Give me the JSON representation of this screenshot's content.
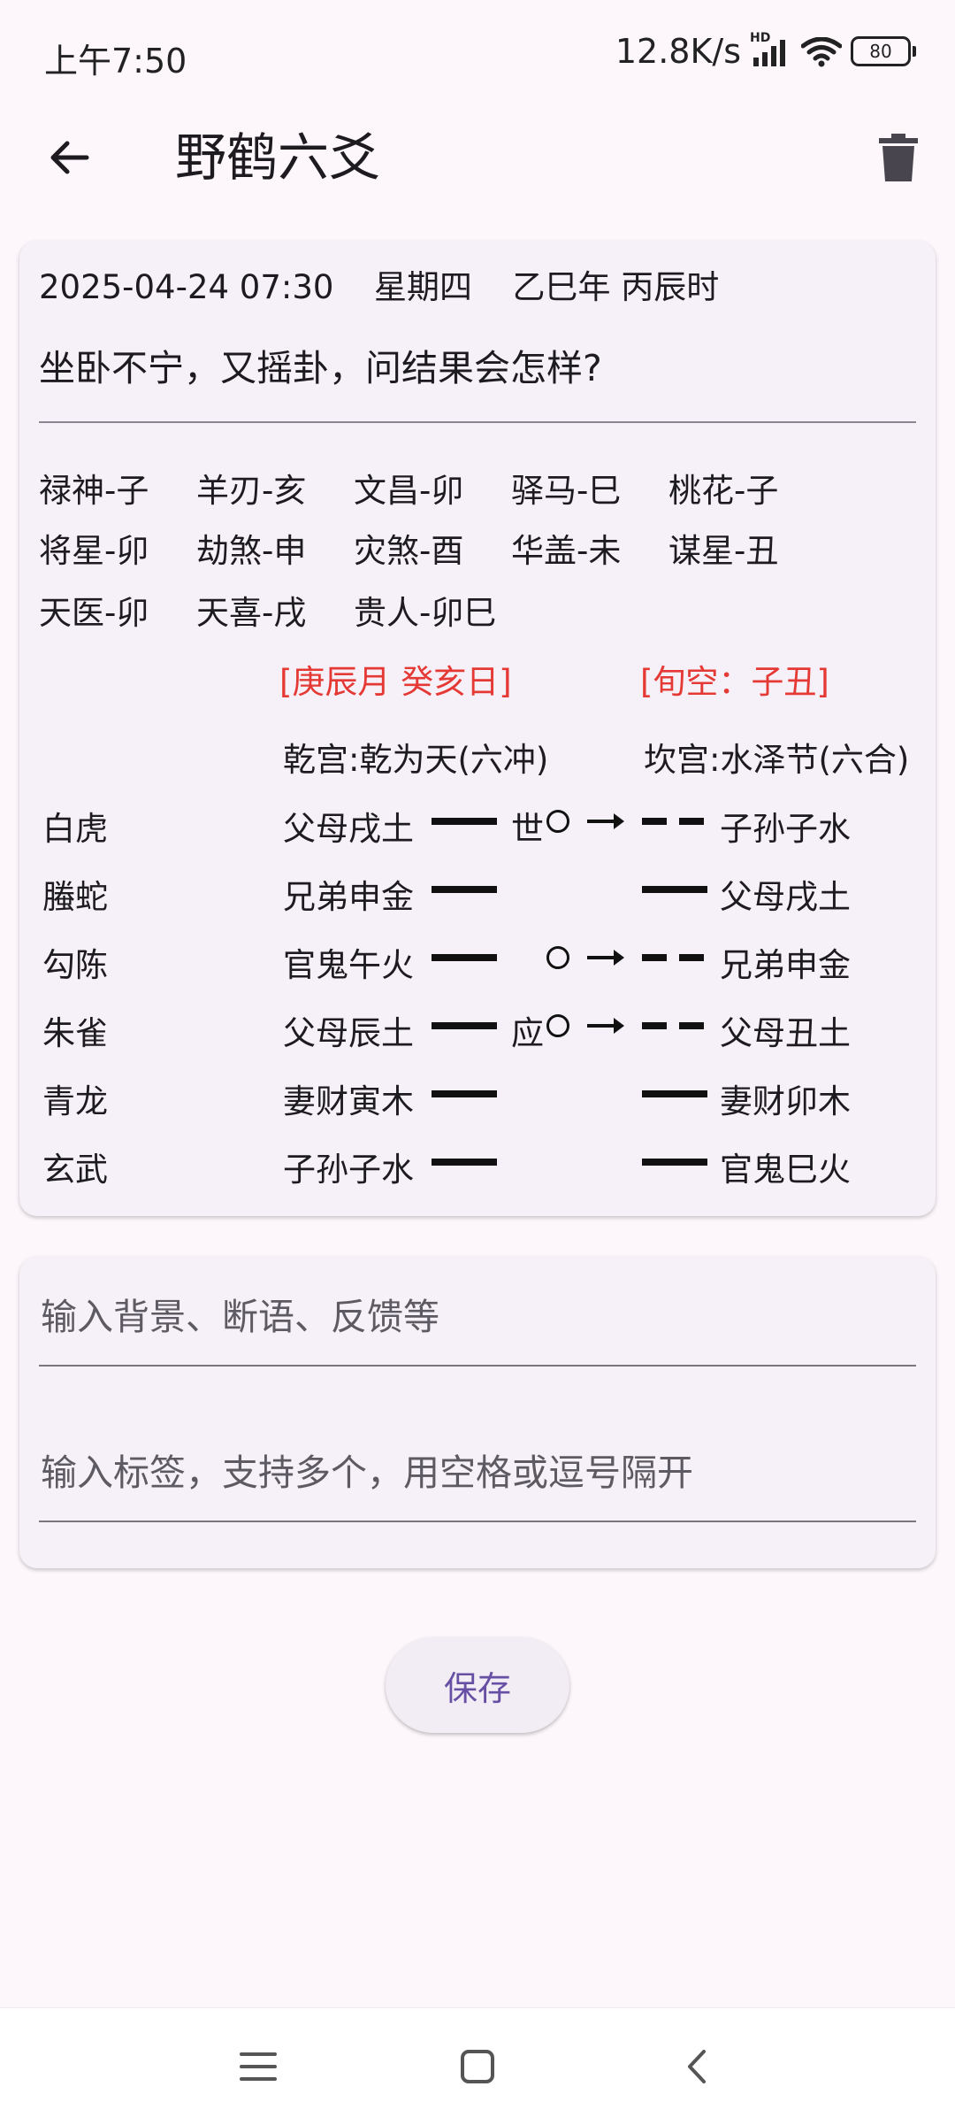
{
  "status_bar": {
    "time": "上午7:50",
    "network_speed": "12.8K/s",
    "hd_label": "HD",
    "battery_level": "80",
    "icons": [
      "signal-icon",
      "wifi-icon",
      "battery-icon"
    ]
  },
  "app_bar": {
    "title": "野鹤六爻",
    "back_icon": "arrow-left-icon",
    "delete_icon": "trash-icon"
  },
  "divination": {
    "datetime": "2025-04-24 07:30",
    "weekday": "星期四",
    "ganzhi": "乙巳年 丙辰时",
    "question": "坐卧不宁，又摇卦，问结果会怎样?",
    "shensha": [
      [
        "禄神-子",
        "羊刃-亥",
        "文昌-卯",
        "驿马-巳",
        "桃花-子"
      ],
      [
        "将星-卯",
        "劫煞-申",
        "灾煞-酉",
        "华盖-未",
        "谋星-丑"
      ],
      [
        "天医-卯",
        "天喜-戌",
        "贵人-卯巳"
      ]
    ],
    "month_day": "[庚辰月  癸亥日]",
    "xunkong": "[旬空：子丑]",
    "main_gua": "乾宫:乾为天(六冲)",
    "changed_gua": "坎宫:水泽节(六合)",
    "yao_lines": [
      {
        "god": "白虎",
        "main": "父母戌土",
        "main_type": "yang",
        "mark": "世",
        "moving": true,
        "changed_type": "yin",
        "changed": "子孙子水"
      },
      {
        "god": "螣蛇",
        "main": "兄弟申金",
        "main_type": "yang",
        "mark": "",
        "moving": false,
        "changed_type": "yang",
        "changed": "父母戌土"
      },
      {
        "god": "勾陈",
        "main": "官鬼午火",
        "main_type": "yang",
        "mark": "",
        "moving": true,
        "changed_type": "yin",
        "changed": "兄弟申金"
      },
      {
        "god": "朱雀",
        "main": "父母辰土",
        "main_type": "yang",
        "mark": "应",
        "moving": true,
        "changed_type": "yin",
        "changed": "父母丑土"
      },
      {
        "god": "青龙",
        "main": "妻财寅木",
        "main_type": "yang",
        "mark": "",
        "moving": false,
        "changed_type": "yang",
        "changed": "妻财卯木"
      },
      {
        "god": "玄武",
        "main": "子孙子水",
        "main_type": "yang",
        "mark": "",
        "moving": false,
        "changed_type": "yang",
        "changed": "官鬼巳火"
      }
    ]
  },
  "notes_form": {
    "background_value": "",
    "background_placeholder": "输入背景、断语、反馈等",
    "tags_value": "",
    "tags_placeholder": "输入标签，支持多个，用空格或逗号隔开"
  },
  "save_label": "保存",
  "nav_bar": {
    "icons": [
      "menu-icon",
      "home-icon",
      "back-icon"
    ]
  },
  "colors": {
    "background": "#fdf7fc",
    "card": "#f6f1f8",
    "accent": "#6750a4",
    "highlight_red": "#e53935"
  }
}
